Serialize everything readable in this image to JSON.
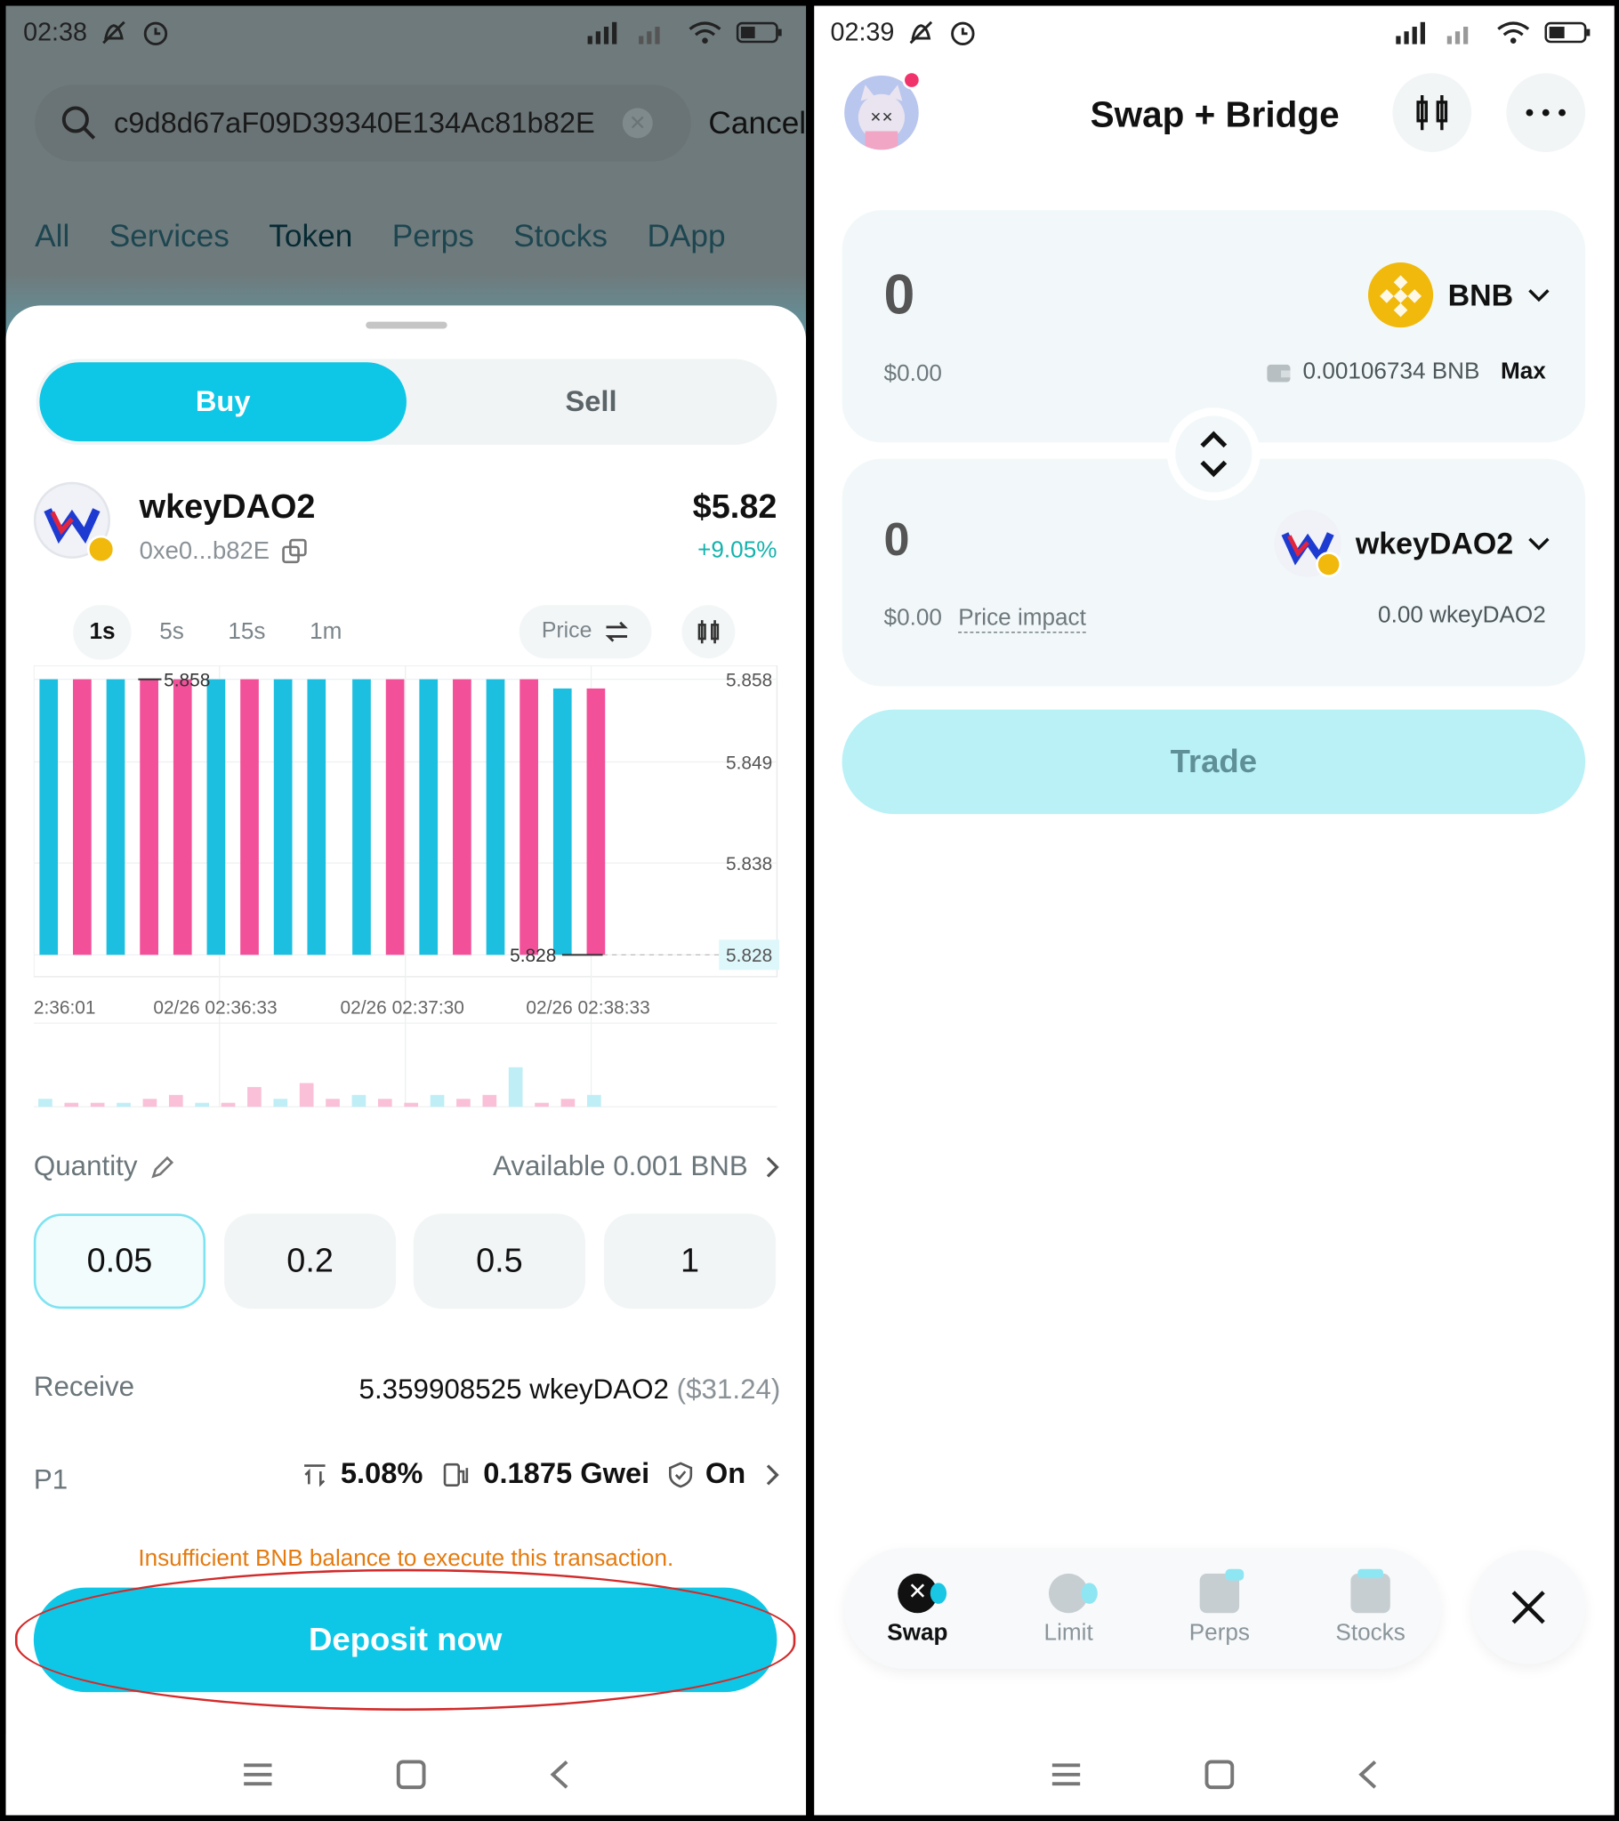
{
  "left": {
    "status": {
      "time": "02:38"
    },
    "search": {
      "value": "c9d8d67aF09D39340E134Ac81b82E",
      "cancel": "Cancel"
    },
    "tabs": [
      "All",
      "Services",
      "Token",
      "Perps",
      "Stocks",
      "DApp"
    ],
    "active_tab": "Token",
    "trade_toggle": {
      "buy": "Buy",
      "sell": "Sell"
    },
    "token": {
      "name": "wkeyDAO2",
      "address": "0xe0...b82E",
      "price": "$5.82",
      "change": "+9.05%"
    },
    "intervals": [
      "1s",
      "5s",
      "15s",
      "1m"
    ],
    "active_interval": "1s",
    "price_toggle": "Price",
    "chart_data": {
      "type": "candlestick",
      "y_ticks": [
        "5.858",
        "5.849",
        "5.838",
        "5.828"
      ],
      "x_ticks": [
        "2:36:01",
        "02/26 02:36:33",
        "02/26 02:37:30",
        "02/26 02:38:33"
      ],
      "annotations": {
        "high": "5.858",
        "low": "5.828",
        "last": "5.828"
      },
      "ylim": [
        5.826,
        5.859
      ],
      "candles": [
        {
          "dir": "up",
          "open": 5.828,
          "close": 5.858
        },
        {
          "dir": "down",
          "open": 5.858,
          "close": 5.828
        },
        {
          "dir": "up",
          "open": 5.828,
          "close": 5.858
        },
        {
          "dir": "down",
          "open": 5.858,
          "close": 5.828
        },
        {
          "dir": "down",
          "open": 5.858,
          "close": 5.828
        },
        {
          "dir": "up",
          "open": 5.828,
          "close": 5.858
        },
        {
          "dir": "down",
          "open": 5.858,
          "close": 5.828
        },
        {
          "dir": "up",
          "open": 5.828,
          "close": 5.858
        },
        {
          "dir": "up",
          "open": 5.828,
          "close": 5.858
        },
        {
          "dir": "up",
          "open": 5.828,
          "close": 5.858
        },
        {
          "dir": "down",
          "open": 5.858,
          "close": 5.828
        },
        {
          "dir": "up",
          "open": 5.828,
          "close": 5.858
        },
        {
          "dir": "down",
          "open": 5.858,
          "close": 5.828
        },
        {
          "dir": "up",
          "open": 5.828,
          "close": 5.858
        },
        {
          "dir": "down",
          "open": 5.858,
          "close": 5.828
        },
        {
          "dir": "up",
          "open": 5.828,
          "close": 5.857
        },
        {
          "dir": "down",
          "open": 5.857,
          "close": 5.828
        }
      ],
      "volumes": [
        2,
        1,
        1,
        1,
        2,
        3,
        1,
        1,
        5,
        2,
        6,
        2,
        3,
        2,
        1,
        3,
        2,
        3,
        10,
        1,
        2,
        3
      ]
    },
    "quantity": {
      "label": "Quantity",
      "available": "Available 0.001 BNB",
      "presets": [
        "0.05",
        "0.2",
        "0.5",
        "1"
      ]
    },
    "receive": {
      "label": "Receive",
      "amount": "5.359908525 wkeyDAO2",
      "usd": "($31.24)"
    },
    "p1": {
      "label": "P1",
      "slippage": "5.08%",
      "gas": "0.1875 Gwei",
      "mev": "On"
    },
    "warning": "Insufficient BNB balance to execute this transaction.",
    "deposit": "Deposit now",
    "colors": {
      "up": "#1cbfdf",
      "down": "#f3509a",
      "accent": "#0ec7e6",
      "warning": "#e47b10",
      "highlight": "#d22b2b"
    }
  },
  "right": {
    "status": {
      "time": "02:39"
    },
    "title": "Swap + Bridge",
    "from": {
      "amount": "0",
      "usd": "$0.00",
      "token": "BNB",
      "balance": "0.00106734 BNB",
      "max": "Max"
    },
    "to": {
      "amount": "0",
      "usd": "$0.00",
      "price_impact": "Price impact",
      "token": "wkeyDAO2",
      "balance": "0.00 wkeyDAO2"
    },
    "trade": "Trade",
    "dock": [
      "Swap",
      "Limit",
      "Perps",
      "Stocks"
    ]
  }
}
